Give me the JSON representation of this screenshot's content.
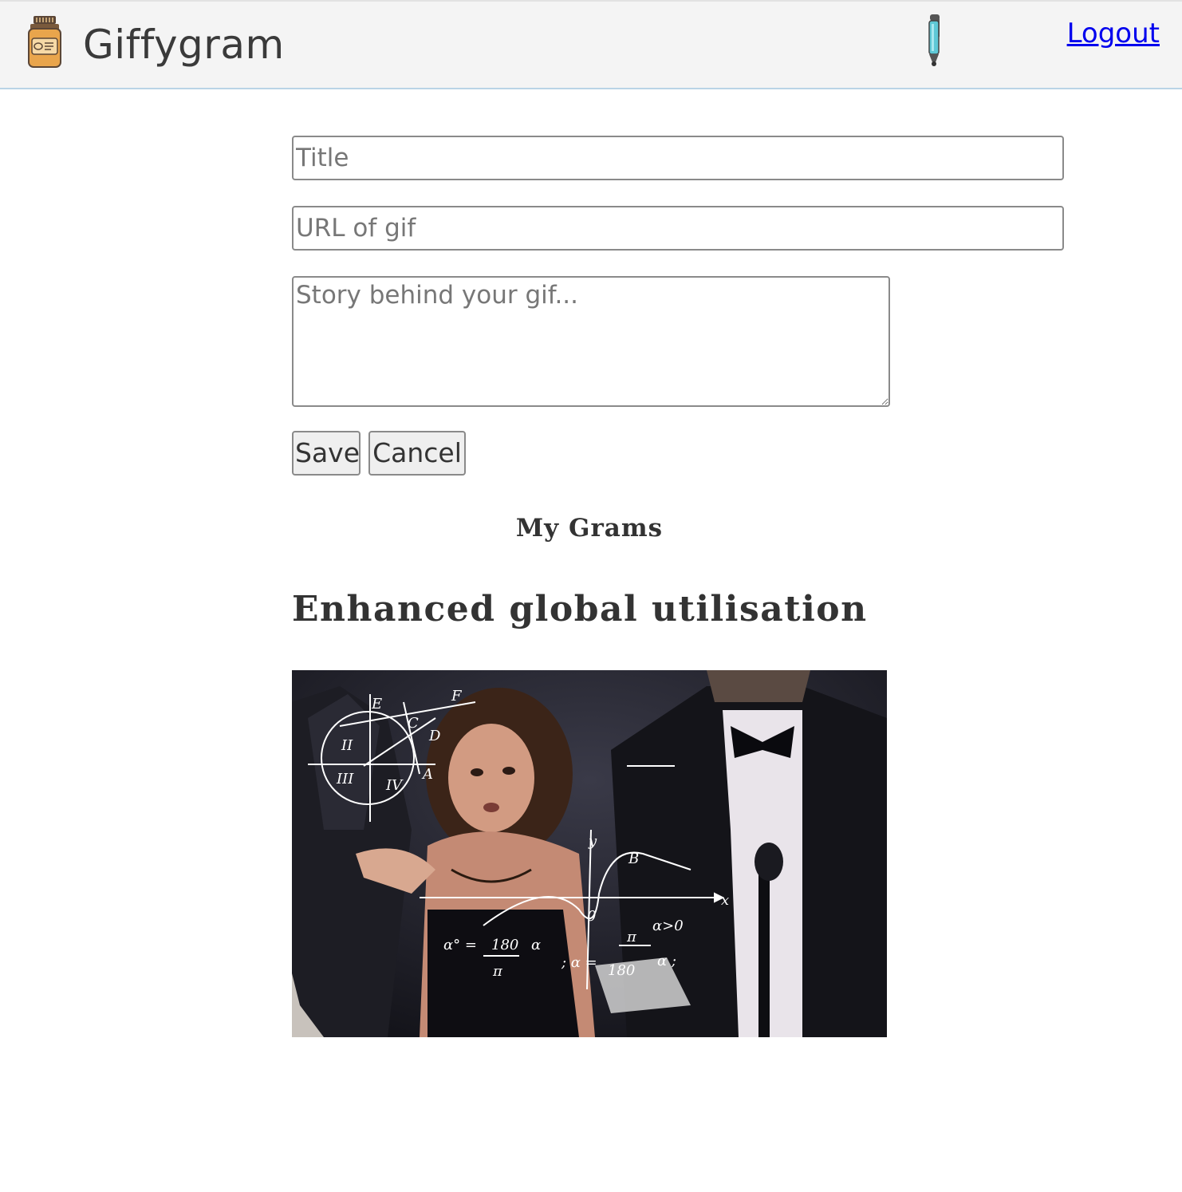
{
  "header": {
    "brand": "Giffygram",
    "logout_label": "Logout",
    "icons": {
      "logo": "jar-icon",
      "new_post": "pen-icon"
    }
  },
  "form": {
    "title_placeholder": "Title",
    "title_value": "",
    "url_placeholder": "URL of gif",
    "url_value": "",
    "story_placeholder": "Story behind your gif...",
    "story_value": "",
    "save_label": "Save",
    "cancel_label": "Cancel"
  },
  "feed": {
    "heading": "My Grams",
    "posts": [
      {
        "title": "Enhanced global utilisation",
        "gif_description": "math-lady-meme-gif"
      }
    ]
  },
  "colors": {
    "navbar_bg": "#f4f4f4",
    "navbar_border": "#b9d4e6",
    "link": "#0000ee",
    "text": "#333333"
  }
}
